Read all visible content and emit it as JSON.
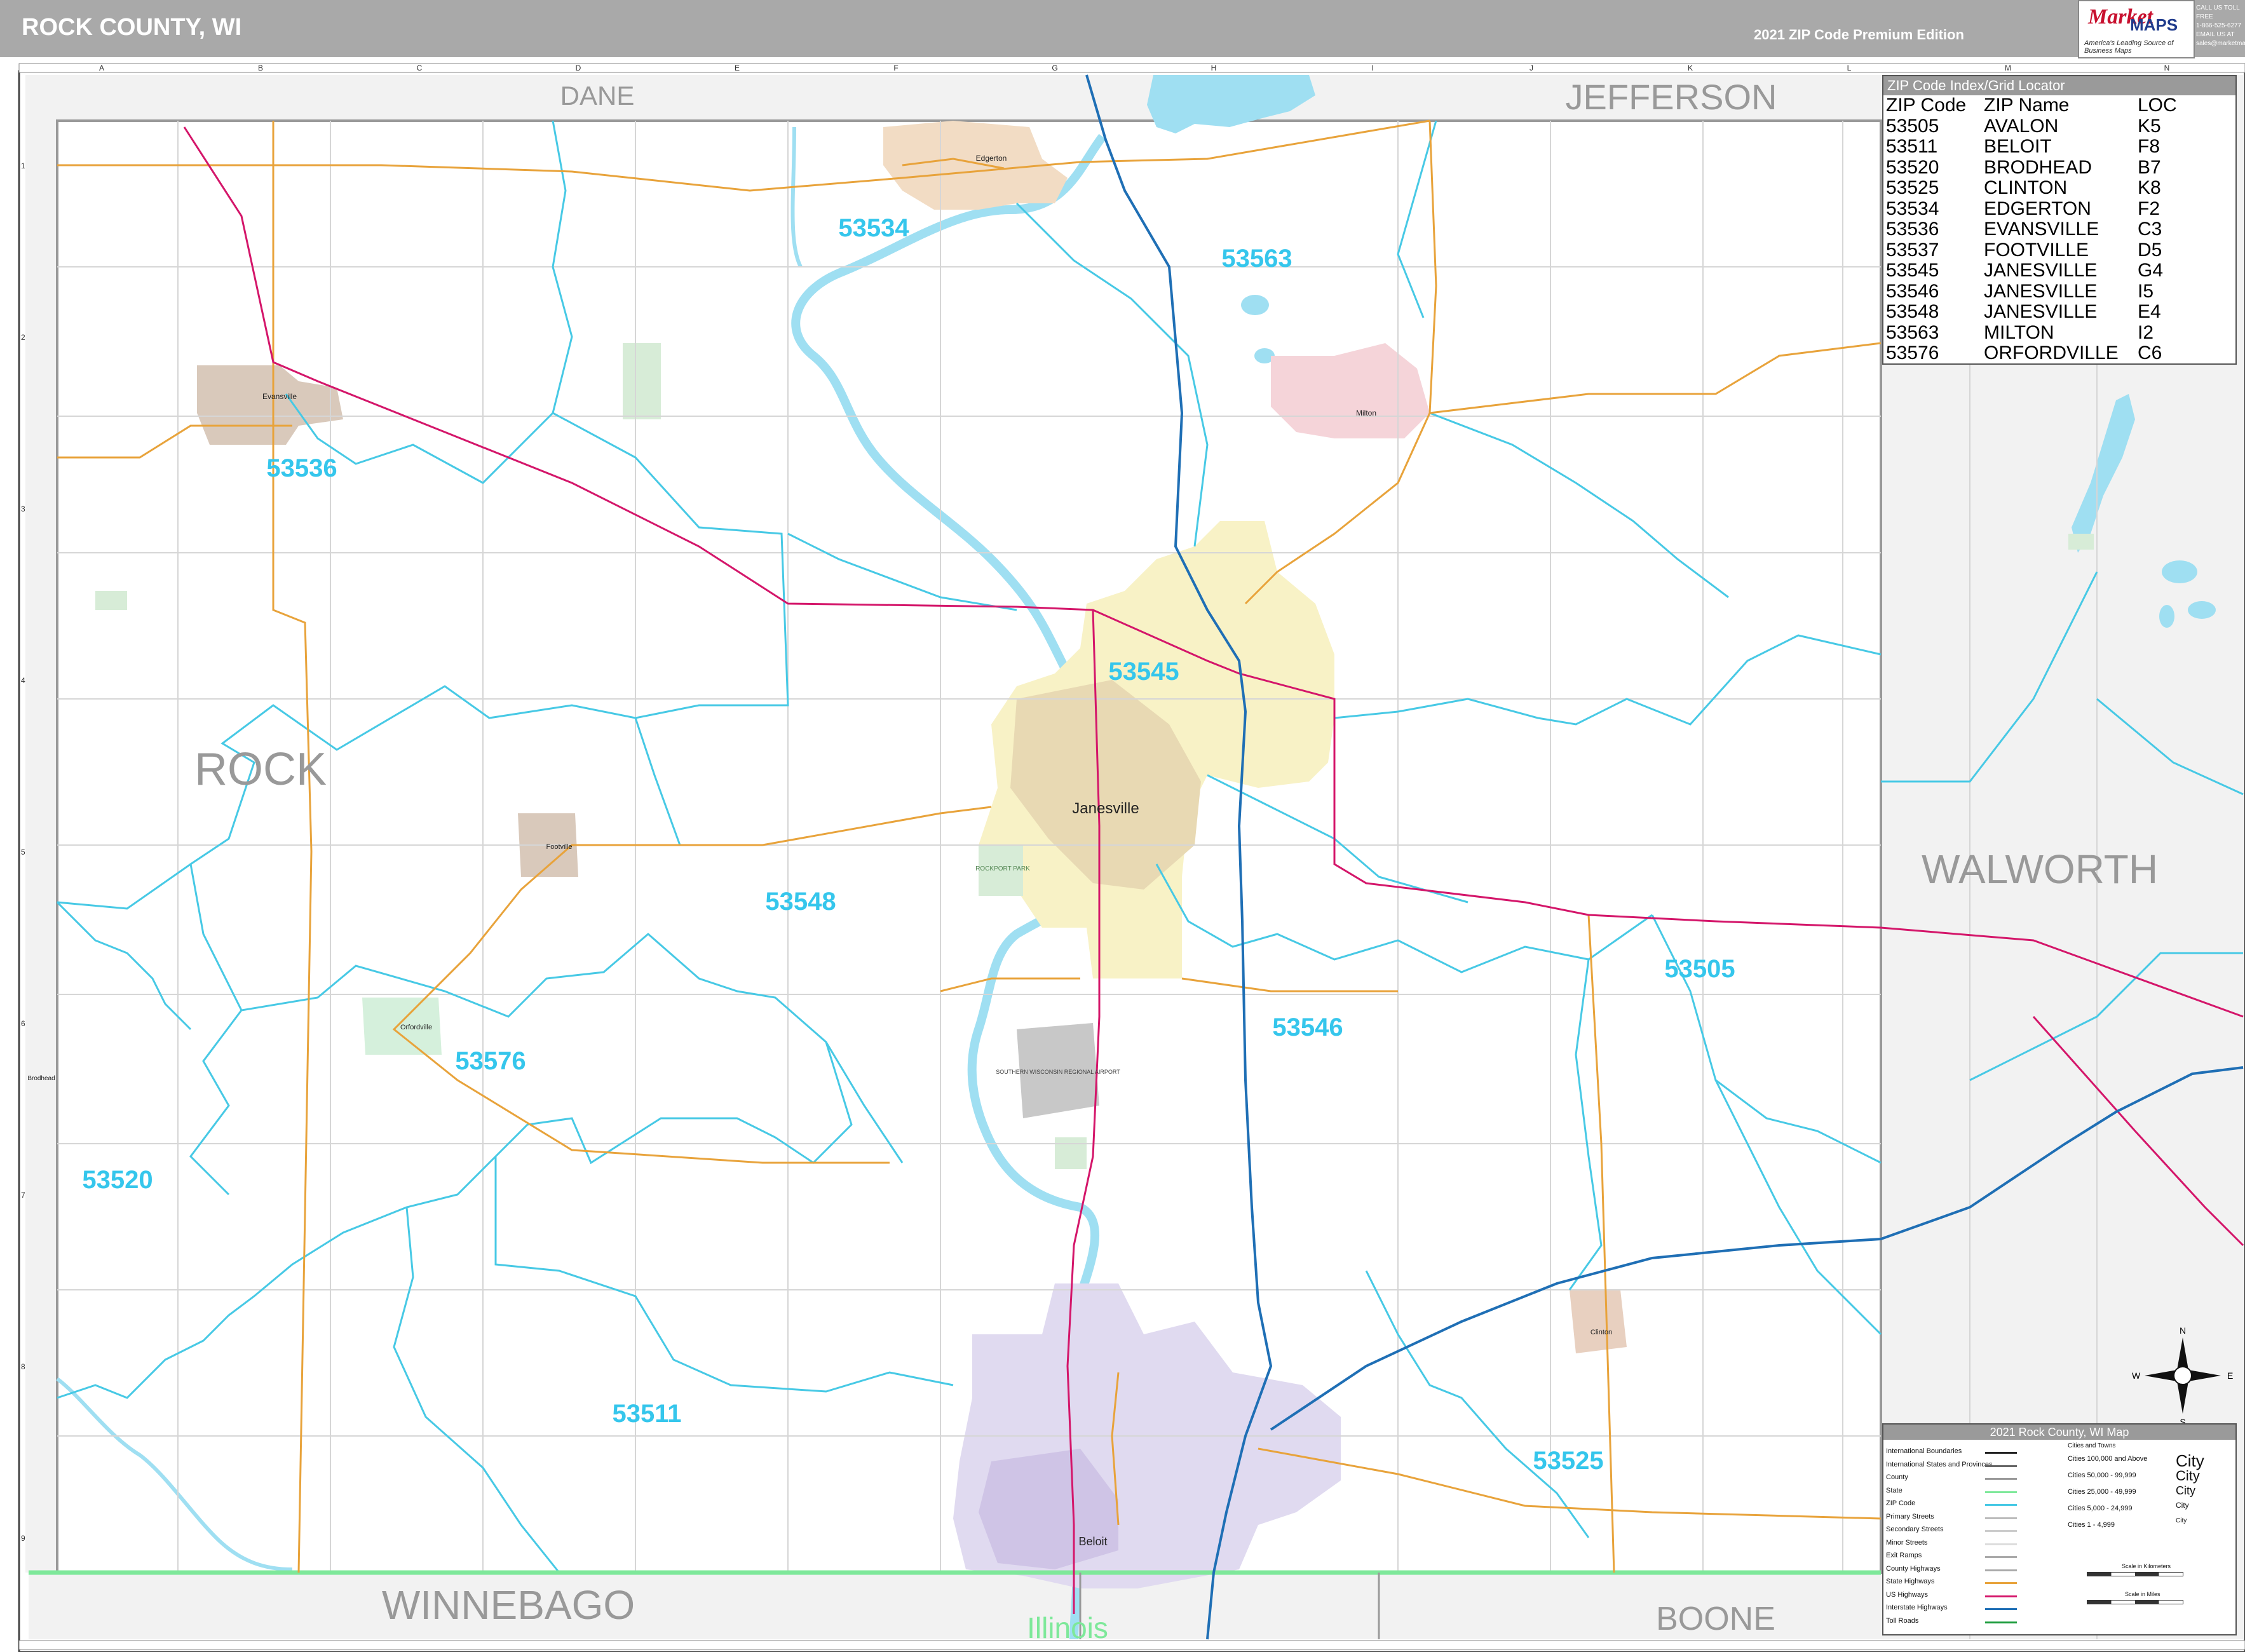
{
  "header": {
    "title": "ROCK COUNTY, WI",
    "edition": "2021 ZIP Code Premium Edition",
    "logo_main": "Market",
    "logo_maps": "MAPS",
    "logo_tagline": "America's Leading Source of Business Maps",
    "logo_contact": [
      "CALL US TOLL FREE",
      "1-866-525-6277",
      "EMAIL US AT",
      "sales@marketmaps.com"
    ]
  },
  "grid": {
    "columns": [
      "A",
      "B",
      "C",
      "D",
      "E",
      "F",
      "G",
      "H",
      "I",
      "J",
      "K",
      "L",
      "M",
      "N"
    ],
    "rows": [
      "1",
      "2",
      "3",
      "4",
      "5",
      "6",
      "7",
      "8",
      "9"
    ]
  },
  "counties": {
    "dane": "DANE",
    "jefferson": "JEFFERSON",
    "rock": "ROCK",
    "walworth": "WALWORTH",
    "winnebago": "WINNEBAGO",
    "boone": "BOONE",
    "state_illinois": "Illinois"
  },
  "zip_labels": {
    "z53534": "53534",
    "z53563": "53563",
    "z53536": "53536",
    "z53545": "53545",
    "z53548": "53548",
    "z53505": "53505",
    "z53576": "53576",
    "z53546": "53546",
    "z53520": "53520",
    "z53511": "53511",
    "z53525": "53525"
  },
  "places": {
    "janesville": "Janesville",
    "beloit": "Beloit",
    "milton": "Milton",
    "edgerton": "Edgerton",
    "evansville": "Evansville",
    "orfordville": "Orfordville",
    "footville": "Footville",
    "clinton": "Clinton",
    "brodhead": "Brodhead",
    "rockport_park": "ROCKPORT PARK",
    "airport": "SOUTHERN WISCONSIN REGIONAL AIRPORT"
  },
  "zip_index": {
    "caption": "ZIP Code Index/Grid Locator",
    "headers": [
      "ZIP Code",
      "ZIP Name",
      "LOC"
    ],
    "rows": [
      {
        "zip": "53505",
        "name": "AVALON",
        "loc": "K5"
      },
      {
        "zip": "53511",
        "name": "BELOIT",
        "loc": "F8"
      },
      {
        "zip": "53520",
        "name": "BRODHEAD",
        "loc": "B7"
      },
      {
        "zip": "53525",
        "name": "CLINTON",
        "loc": "K8"
      },
      {
        "zip": "53534",
        "name": "EDGERTON",
        "loc": "F2"
      },
      {
        "zip": "53536",
        "name": "EVANSVILLE",
        "loc": "C3"
      },
      {
        "zip": "53537",
        "name": "FOOTVILLE",
        "loc": "D5"
      },
      {
        "zip": "53545",
        "name": "JANESVILLE",
        "loc": "G4"
      },
      {
        "zip": "53546",
        "name": "JANESVILLE",
        "loc": "I5"
      },
      {
        "zip": "53548",
        "name": "JANESVILLE",
        "loc": "E4"
      },
      {
        "zip": "53563",
        "name": "MILTON",
        "loc": "I2"
      },
      {
        "zip": "53576",
        "name": "ORFORDVILLE",
        "loc": "C6"
      }
    ]
  },
  "compass": {
    "n": "N",
    "s": "S",
    "e": "E",
    "w": "W"
  },
  "legend": {
    "title": "2021 Rock County, WI Map",
    "lines": [
      {
        "label": "International Boundaries",
        "color": "#222222"
      },
      {
        "label": "International States and Provinces",
        "color": "#666666"
      },
      {
        "label": "County",
        "color": "#999999"
      },
      {
        "label": "State",
        "color": "#7ee89a"
      },
      {
        "label": "ZIP Code",
        "color": "#47c9e5"
      },
      {
        "label": "Primary Streets",
        "color": "#bbbbbb"
      },
      {
        "label": "Secondary Streets",
        "color": "#cccccc"
      },
      {
        "label": "Minor Streets",
        "color": "#dddddd"
      },
      {
        "label": "Exit Ramps",
        "color": "#aaaaaa"
      },
      {
        "label": "County Highways",
        "color": "#aaaaaa"
      },
      {
        "label": "State Highways",
        "color": "#e8a33b"
      },
      {
        "label": "US Highways",
        "color": "#d4166a"
      },
      {
        "label": "Interstate Highways",
        "color": "#1f6fb5"
      },
      {
        "label": "Toll Roads",
        "color": "#1a9b3a"
      }
    ],
    "cities_header": "Cities and Towns",
    "cities": [
      {
        "label": "Cities 100,000 and Above",
        "sample": "City"
      },
      {
        "label": "Cities 50,000 - 99,999",
        "sample": "City"
      },
      {
        "label": "Cities 25,000 - 49,999",
        "sample": "City"
      },
      {
        "label": "Cities 5,000 - 24,999",
        "sample": "City"
      },
      {
        "label": "Cities 1 - 4,999",
        "sample": "City"
      }
    ],
    "scale_km": "Scale in Kilometers",
    "scale_mi": "Scale in Miles"
  },
  "colors": {
    "zip_boundary": "#47c9e5",
    "zip_label": "#35c6ec",
    "interstate": "#1f6fb5",
    "us_highway": "#d4166a",
    "state_highway": "#e8a33b",
    "water": "#9fdff2",
    "state_line": "#7ee89a",
    "outside_county": "#f2f2f2"
  }
}
